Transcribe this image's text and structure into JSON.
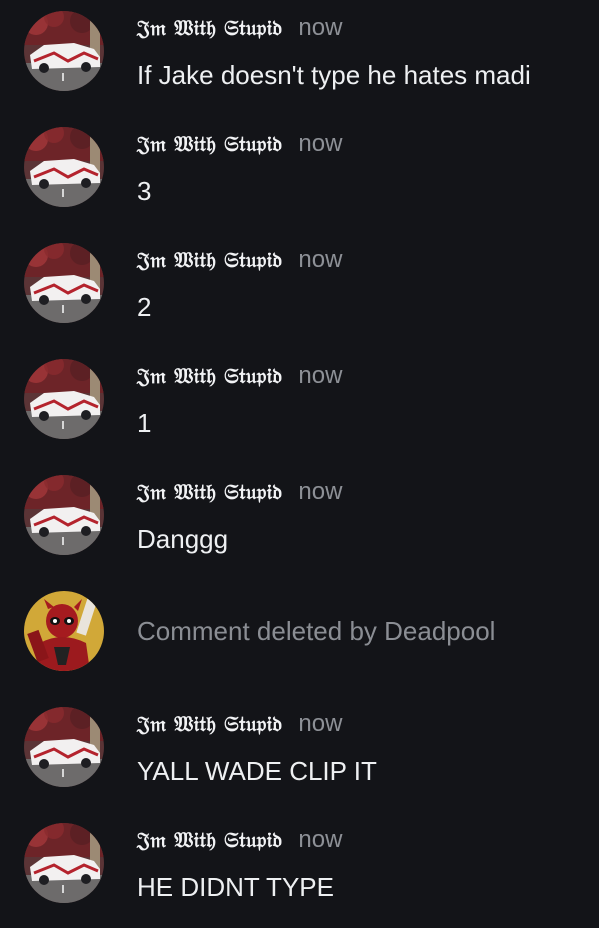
{
  "comments": [
    {
      "author": "𝔍𝔪 𝔚𝔦𝔱𝔥 𝔖𝔱𝔲𝔭𝔦𝔡",
      "time": "now",
      "text": "If Jake doesn't type he hates madi",
      "avatar": "car-avatar"
    },
    {
      "author": "𝔍𝔪 𝔚𝔦𝔱𝔥 𝔖𝔱𝔲𝔭𝔦𝔡",
      "time": "now",
      "text": "3",
      "avatar": "car-avatar"
    },
    {
      "author": "𝔍𝔪 𝔚𝔦𝔱𝔥 𝔖𝔱𝔲𝔭𝔦𝔡",
      "time": "now",
      "text": "2",
      "avatar": "car-avatar"
    },
    {
      "author": "𝔍𝔪 𝔚𝔦𝔱𝔥 𝔖𝔱𝔲𝔭𝔦𝔡",
      "time": "now",
      "text": "1",
      "avatar": "car-avatar"
    },
    {
      "author": "𝔍𝔪 𝔚𝔦𝔱𝔥 𝔖𝔱𝔲𝔭𝔦𝔡",
      "time": "now",
      "text": "Danggg",
      "avatar": "car-avatar"
    }
  ],
  "deleted_comment": {
    "text": "Comment deleted by Deadpool",
    "avatar": "deadpool-avatar"
  },
  "comments_after": [
    {
      "author": "𝔍𝔪 𝔚𝔦𝔱𝔥 𝔖𝔱𝔲𝔭𝔦𝔡",
      "time": "now",
      "text": "YALL WADE CLIP IT",
      "avatar": "car-avatar"
    },
    {
      "author": "𝔍𝔪 𝔚𝔦𝔱𝔥 𝔖𝔱𝔲𝔭𝔦𝔡",
      "time": "now",
      "text": "HE DIDNT TYPE",
      "avatar": "car-avatar"
    }
  ],
  "colors": {
    "background": "#131418",
    "text": "#eef0f2",
    "muted": "#8d9096"
  }
}
